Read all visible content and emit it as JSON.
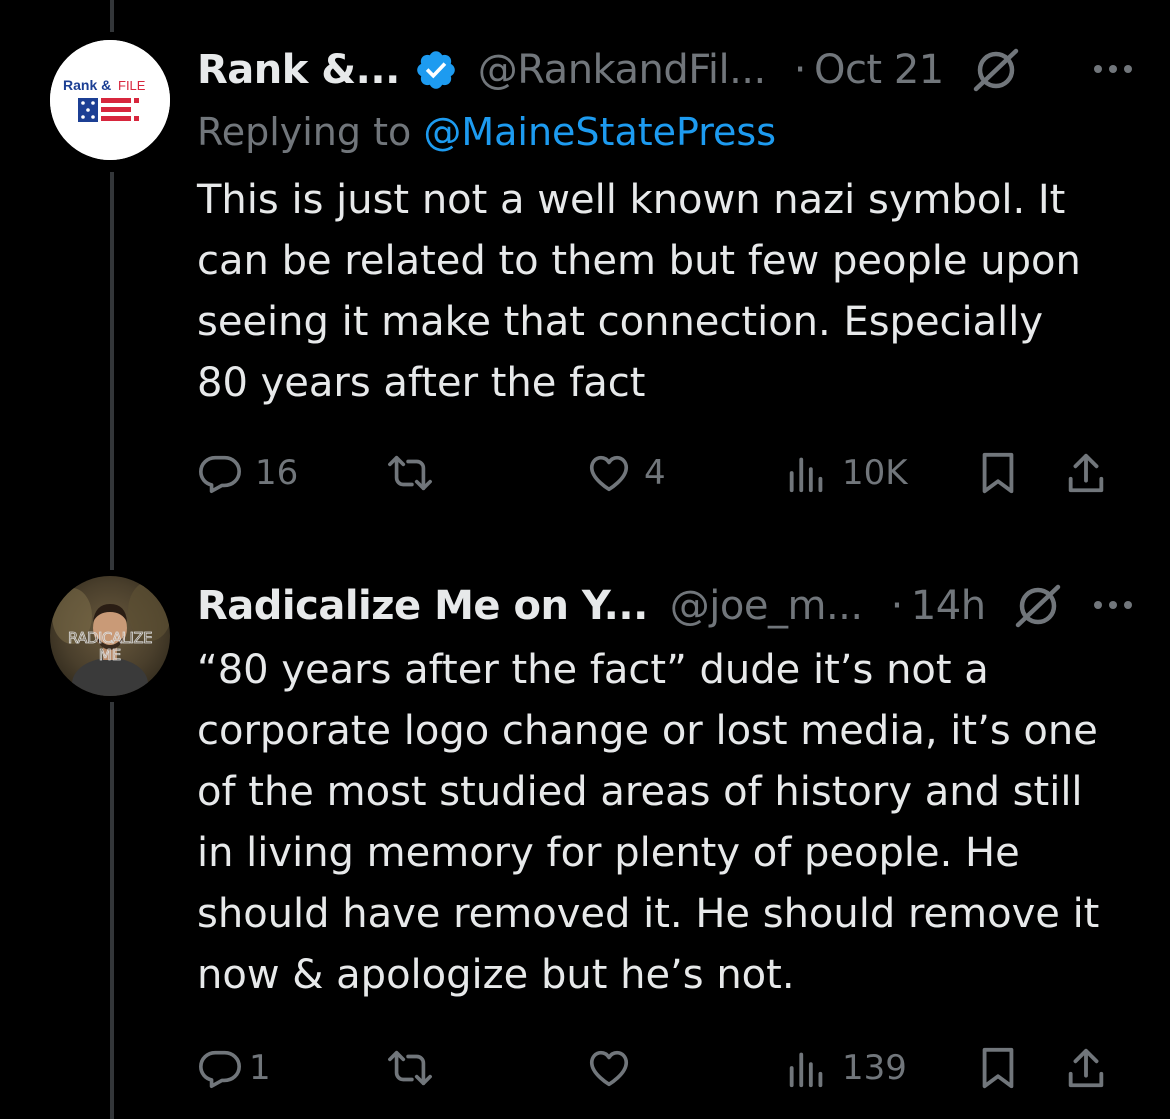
{
  "tweets": [
    {
      "avatar": {
        "brand_text": "Rank & FILE",
        "bg": "#ffffff",
        "red": "#d7263d",
        "blue": "#1c3f94"
      },
      "name": "Rank &...",
      "verified": true,
      "handle": "@RankandFil...",
      "dot": "·",
      "time": "Oct 21",
      "replying_prefix": "Replying to",
      "replying_mention": "@MaineStatePress",
      "body": [
        "This is just not a well known nazi symbol. It",
        "can be related to them but few people upon",
        "seeing it make that connection. Especially",
        "80 years after the fact"
      ],
      "counts": {
        "replies": "16",
        "retweets": "",
        "likes": "4",
        "views": "10K"
      }
    },
    {
      "avatar": {
        "overlay_text": "RADICALIZE ME"
      },
      "name": "Radicalize Me on Y...",
      "verified": false,
      "handle": "@joe_m...",
      "dot": "·",
      "time": "14h",
      "body": [
        "“80 years after the fact” dude it’s not a",
        "corporate logo change or lost media, it’s one",
        "of the most studied areas of history and still",
        "in living memory for plenty of people. He",
        "should have removed it. He should remove it",
        "now & apologize but he’s not."
      ],
      "counts": {
        "replies": "1",
        "retweets": "",
        "likes": "",
        "views": "139"
      }
    }
  ],
  "colors": {
    "accent": "#1d9bf0",
    "muted": "#71767b",
    "text": "#e7e9ea",
    "background": "#000000"
  },
  "icons": [
    "verified-badge-icon",
    "edit-history-icon",
    "more-icon",
    "reply-icon",
    "retweet-icon",
    "like-icon",
    "views-icon",
    "bookmark-icon",
    "share-icon"
  ]
}
